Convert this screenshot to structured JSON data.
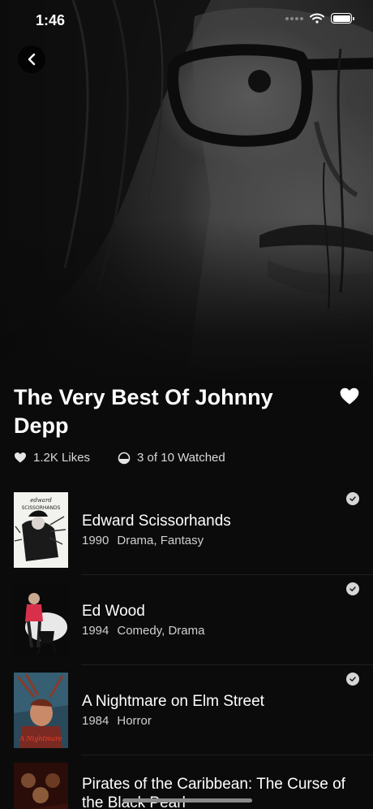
{
  "status_bar": {
    "time": "1:46"
  },
  "header": {
    "back_icon": "chevron-left-icon"
  },
  "collection": {
    "title": "The Very Best Of Johnny Depp",
    "favorite_icon": "heart-icon",
    "likes": "1.2K Likes",
    "watched": "3 of 10 Watched"
  },
  "movies": [
    {
      "title": "Edward Scissorhands",
      "year": "1990",
      "genres": "Drama, Fantasy",
      "watched": true,
      "poster_text": "edward SCISSORHANDS"
    },
    {
      "title": "Ed Wood",
      "year": "1994",
      "genres": "Comedy, Drama",
      "watched": true
    },
    {
      "title": "A Nightmare on Elm Street",
      "year": "1984",
      "genres": "Horror",
      "watched": true,
      "poster_text": "A Nightmare"
    },
    {
      "title": "Pirates of the Caribbean: The Curse of the Black Pearl",
      "watched": false
    }
  ],
  "colors": {
    "background": "#0b0b0b",
    "text": "#ffffff",
    "muted": "#cfcfcf",
    "check": "#d6d6d6"
  }
}
